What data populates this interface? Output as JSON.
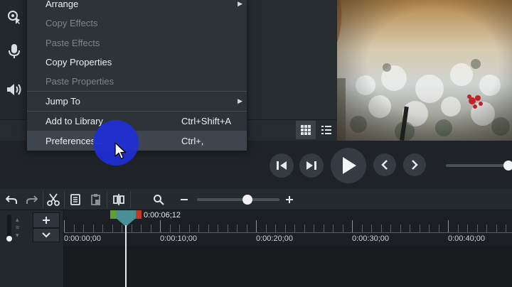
{
  "menu": {
    "items": [
      {
        "label": "Arrange",
        "shortcut": "",
        "submenu": true,
        "disabled": false
      },
      {
        "label": "Copy Effects",
        "shortcut": "",
        "submenu": false,
        "disabled": true
      },
      {
        "label": "Paste Effects",
        "shortcut": "",
        "submenu": false,
        "disabled": true
      },
      {
        "label": "Copy Properties",
        "shortcut": "",
        "submenu": false,
        "disabled": false
      },
      {
        "label": "Paste Properties",
        "shortcut": "",
        "submenu": false,
        "disabled": true
      },
      {
        "label": "Jump To",
        "shortcut": "",
        "submenu": true,
        "disabled": false
      },
      {
        "label": "Add to Library",
        "shortcut": "Ctrl+Shift+A",
        "submenu": false,
        "disabled": false
      },
      {
        "label": "Preferences...",
        "shortcut": "Ctrl+,",
        "submenu": false,
        "disabled": false,
        "highlighted": true
      }
    ]
  },
  "timeline": {
    "playhead_time": "0:00:06;12",
    "ruler_labels": [
      "0:00:00;00",
      "0:00:10;00",
      "0:00:20;00",
      "0:00:30;00",
      "0:00:40;00"
    ],
    "zoom_level": 0.61
  },
  "colors": {
    "accent_blue": "#1f2fd6",
    "playhead_teal": "#4a8f96",
    "in_marker": "#5aa332",
    "out_marker": "#c0392b"
  },
  "icons": {
    "left_tools": [
      "cursor-effects-icon",
      "microphone-icon",
      "speaker-icon"
    ],
    "toolbar": [
      "undo-icon",
      "redo-icon",
      "cut-icon",
      "copy-icon",
      "paste-icon",
      "split-icon",
      "zoom-search-icon"
    ]
  }
}
